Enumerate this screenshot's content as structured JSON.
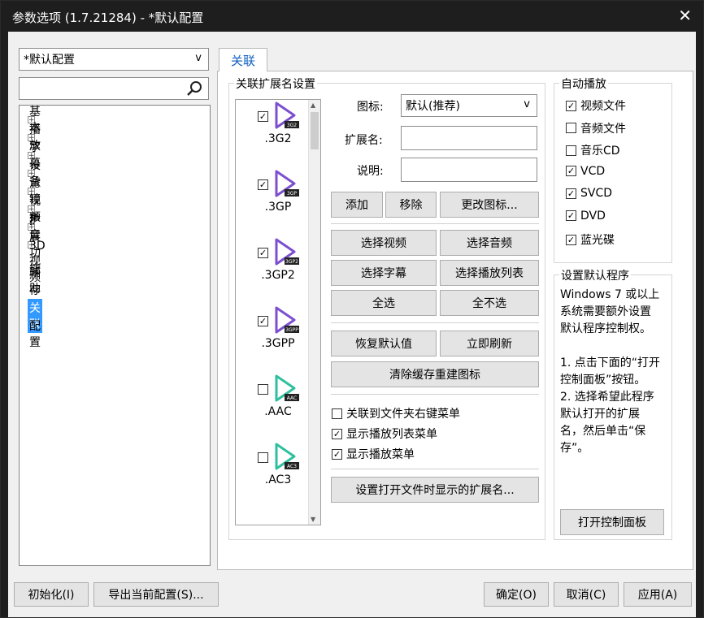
{
  "window": {
    "title": "参数选项 (1.7.21284) - *默认配置",
    "close_glyph": "✕"
  },
  "profile_select": {
    "value": "*默认配置",
    "arrow": "v"
  },
  "search": {
    "value": "",
    "icon": "search-icon"
  },
  "tree": {
    "items": [
      {
        "label": "基本",
        "expandable": true
      },
      {
        "label": "播放",
        "expandable": true
      },
      {
        "label": "字幕",
        "expandable": true
      },
      {
        "label": "设备",
        "expandable": true
      },
      {
        "label": "滤镜",
        "expandable": true
      },
      {
        "label": "视频",
        "expandable": true
      },
      {
        "label": "声音",
        "expandable": true
      },
      {
        "label": "扩展功能",
        "expandable": true
      },
      {
        "label": "3D 视频",
        "expandable": false
      },
      {
        "label": "辅助",
        "expandable": false
      },
      {
        "label": "存档",
        "expandable": false
      },
      {
        "label": "关联",
        "expandable": false,
        "selected": true
      },
      {
        "label": "配置",
        "expandable": false
      }
    ],
    "expander_glyph": "+"
  },
  "tab": {
    "label": "关联"
  },
  "assoc": {
    "group_title": "关联扩展名设置",
    "extensions": [
      {
        "name": ".3G2",
        "badge": "3G2",
        "checked": true,
        "color": "#7b4fcf"
      },
      {
        "name": ".3GP",
        "badge": "3GP",
        "checked": true,
        "color": "#7b4fcf"
      },
      {
        "name": ".3GP2",
        "badge": "3GP2",
        "checked": true,
        "color": "#7b4fcf"
      },
      {
        "name": ".3GPP",
        "badge": "3GPP",
        "checked": true,
        "color": "#7b4fcf"
      },
      {
        "name": ".AAC",
        "badge": "AAC",
        "checked": false,
        "color": "#2fbf9f"
      },
      {
        "name": ".AC3",
        "badge": "AC3",
        "checked": false,
        "color": "#2fbf9f"
      }
    ],
    "icon_label": "图标:",
    "icon_value": "默认(推荐)",
    "ext_label": "扩展名:",
    "desc_label": "说明:",
    "ext_value": "",
    "desc_value": "",
    "buttons": {
      "add": "添加",
      "remove": "移除",
      "change_icon": "更改图标...",
      "select_video": "选择视频",
      "select_audio": "选择音频",
      "select_subtitle": "选择字幕",
      "select_playlist": "选择播放列表",
      "select_all": "全选",
      "select_none": "全不选",
      "restore_default": "恢复默认值",
      "refresh_now": "立即刷新",
      "clear_cache": "清除缓存重建图标",
      "set_open_ext": "设置打开文件时显示的扩展名..."
    },
    "options": [
      {
        "label": "关联到文件夹右键菜单",
        "checked": false
      },
      {
        "label": "显示播放列表菜单",
        "checked": true
      },
      {
        "label": "显示播放菜单",
        "checked": true
      }
    ]
  },
  "autoplay": {
    "title": "自动播放",
    "items": [
      {
        "label": "视频文件",
        "checked": true
      },
      {
        "label": "音频文件",
        "checked": false
      },
      {
        "label": "音乐CD",
        "checked": false
      },
      {
        "label": "VCD",
        "checked": true
      },
      {
        "label": "SVCD",
        "checked": true
      },
      {
        "label": "DVD",
        "checked": true
      },
      {
        "label": "蓝光碟",
        "checked": true
      }
    ]
  },
  "default_program": {
    "title": "设置默认程序",
    "lines": [
      "Windows 7 或以上",
      "系统需要额外设置",
      "默认程序控制权。",
      "",
      "1. 点击下面的“打开",
      "控制面板”按钮。",
      "2. 选择希望此程序",
      "默认打开的扩展",
      "名，然后单击“保",
      "存”。"
    ],
    "button": "打开控制面板"
  },
  "footer": {
    "init": "初始化(I)",
    "export": "导出当前配置(S)...",
    "ok": "确定(O)",
    "cancel": "取消(C)",
    "apply": "应用(A)"
  },
  "check_glyph": "✓"
}
